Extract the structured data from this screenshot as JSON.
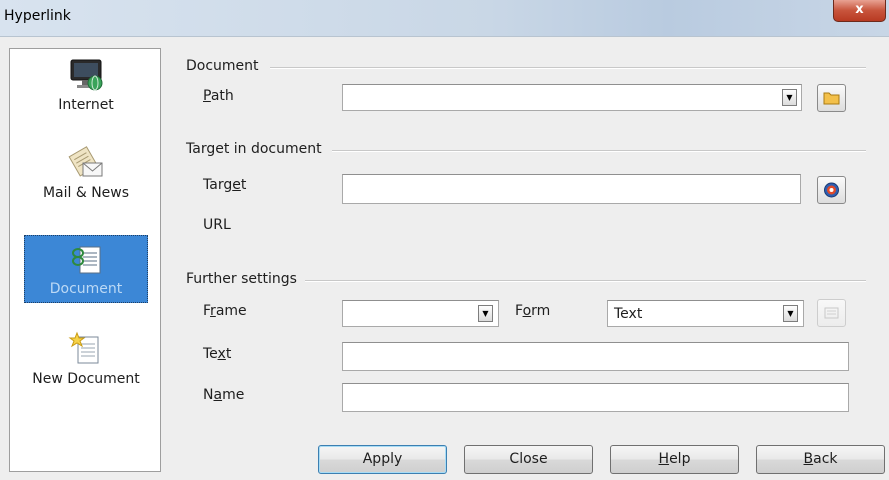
{
  "window": {
    "title": "Hyperlink",
    "close_glyph": "x"
  },
  "sidebar": {
    "items": [
      {
        "label": "Internet",
        "icon": "internet-monitor-icon",
        "active": false
      },
      {
        "label": "Mail & News",
        "icon": "mail-news-icon",
        "active": false
      },
      {
        "label": "Document",
        "icon": "document-link-icon",
        "active": true
      },
      {
        "label": "New Document",
        "icon": "new-document-icon",
        "active": false
      }
    ]
  },
  "document_section": {
    "heading": "Document",
    "path": {
      "label_u": "P",
      "label_rest": "ath",
      "value": ""
    }
  },
  "target_section": {
    "heading": "Target in document",
    "target": {
      "label_pre": "Targ",
      "label_u": "e",
      "label_post": "t",
      "value": ""
    },
    "url": {
      "label": "URL"
    }
  },
  "further_section": {
    "heading": "Further settings",
    "frame": {
      "label_pre": "F",
      "label_u": "r",
      "label_post": "ame",
      "value": ""
    },
    "form": {
      "label_pre": "F",
      "label_u": "o",
      "label_post": "rm",
      "value": "Text"
    },
    "text": {
      "label_pre": "Te",
      "label_u": "x",
      "label_post": "t",
      "value": ""
    },
    "name": {
      "label_pre": "N",
      "label_u": "a",
      "label_post": "me",
      "value": ""
    }
  },
  "buttons": {
    "apply": "Apply",
    "close": "Close",
    "help_u": "H",
    "help_rest": "elp",
    "back_u": "B",
    "back_rest": "ack"
  },
  "colors": {
    "active_item": "#3c87d6",
    "close_button": "#c8543c",
    "folder_icon": "#f3c04a"
  }
}
